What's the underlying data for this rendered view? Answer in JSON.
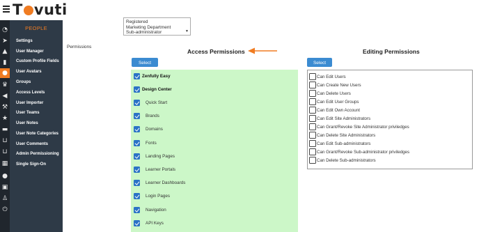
{
  "brand": {
    "logo_prefix": "T",
    "logo_suffix": "vuti"
  },
  "sidebar": {
    "section_title": "PEOPLE",
    "items": [
      {
        "label": "Settings"
      },
      {
        "label": "User Manager"
      },
      {
        "label": "Custom Profile Fields"
      },
      {
        "label": "User Avatars"
      },
      {
        "label": "Groups"
      },
      {
        "label": "Access Levels"
      },
      {
        "label": "User Importer"
      },
      {
        "label": "User Teams"
      },
      {
        "label": "User Notes"
      },
      {
        "label": "User Note Categories"
      },
      {
        "label": "User Comments"
      },
      {
        "label": "Admin Permissioning"
      },
      {
        "label": "Single Sign-On"
      }
    ]
  },
  "icon_strip": [
    "dashboard-icon",
    "rocket-icon",
    "graduation-cap-icon",
    "chart-icon",
    "people-icon",
    "trophy-icon",
    "megaphone-icon",
    "gavel-icon",
    "star-icon",
    "card-icon",
    "cart-icon",
    "cart-icon",
    "calendar-icon",
    "chat-icon",
    "doc-icon",
    "flask-icon",
    "power-icon"
  ],
  "roles": {
    "options": [
      "Registered",
      "Marketing Department",
      "Sub-administrator"
    ]
  },
  "main": {
    "permissions_label": "Permissions",
    "access_title": "Access Permissions",
    "editing_title": "Editing Permissions",
    "select_all_label": "Select All"
  },
  "access_permissions": [
    {
      "label": "Zenfully Easy",
      "checked": true,
      "bold": true
    },
    {
      "label": "Design Center",
      "checked": true,
      "bold": true
    },
    {
      "label": "Quick Start",
      "checked": true
    },
    {
      "label": "Brands",
      "checked": true
    },
    {
      "label": "Domains",
      "checked": true
    },
    {
      "label": "Fonts",
      "checked": true
    },
    {
      "label": "Landing Pages",
      "checked": true
    },
    {
      "label": "Learner Portals",
      "checked": true
    },
    {
      "label": "Learner Dashboards",
      "checked": true
    },
    {
      "label": "Login Pages",
      "checked": true
    },
    {
      "label": "Navigation",
      "checked": true
    },
    {
      "label": "API Keys",
      "checked": true
    }
  ],
  "editing_permissions": [
    {
      "label": "Can Edit Users",
      "checked": false
    },
    {
      "label": "Can Create New Users",
      "checked": false
    },
    {
      "label": "Can Delete Users",
      "checked": false
    },
    {
      "label": "Can Edit User Groups",
      "checked": false
    },
    {
      "label": "Can Edit Own Account",
      "checked": false
    },
    {
      "label": "Can Edit Site Administrators",
      "checked": false
    },
    {
      "label": "Can Grant/Revoke Site Administrator priviledges",
      "checked": false
    },
    {
      "label": "Can Delete Site Administrators",
      "checked": false
    },
    {
      "label": "Can Edit Sub-administrators",
      "checked": false
    },
    {
      "label": "Can Grant/Revoke Sub-administrator priviledges",
      "checked": false
    },
    {
      "label": "Can Delete Sub-administrators",
      "checked": false
    }
  ],
  "colors": {
    "accent": "#f07c22",
    "sidebar_bg": "#2e3a47",
    "button_bg": "#3b8bd1",
    "access_panel_bg": "#ccf7c8",
    "checkbox_checked": "#2b73c6"
  }
}
